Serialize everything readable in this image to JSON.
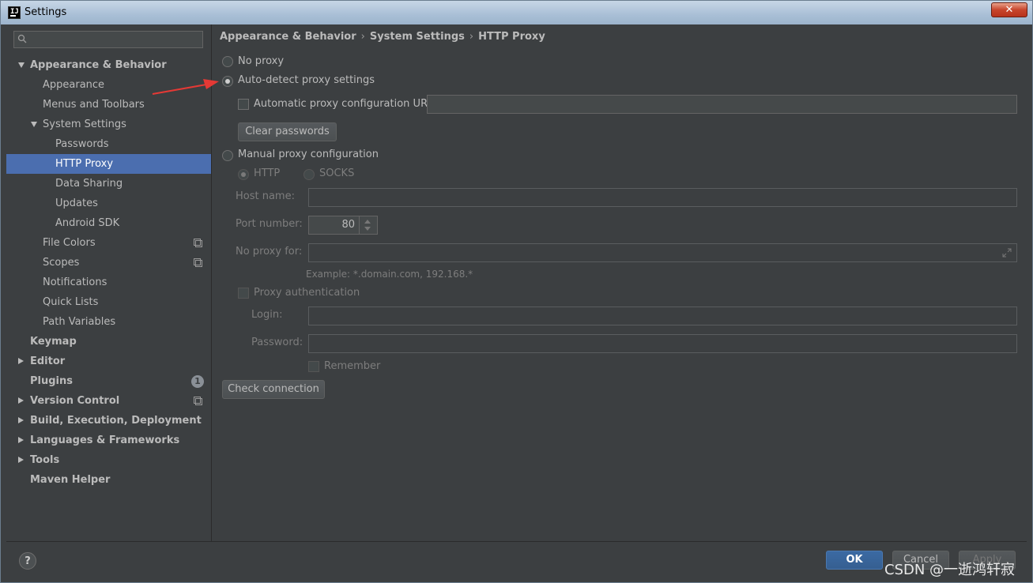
{
  "window": {
    "title": "Settings",
    "close": "✕"
  },
  "app_icon": {
    "glyph": "IJ"
  },
  "sidebar": {
    "search_placeholder": "",
    "items": [
      {
        "label": "Appearance & Behavior"
      },
      {
        "label": "Appearance"
      },
      {
        "label": "Menus and Toolbars"
      },
      {
        "label": "System Settings"
      },
      {
        "label": "Passwords"
      },
      {
        "label": "HTTP Proxy"
      },
      {
        "label": "Data Sharing"
      },
      {
        "label": "Updates"
      },
      {
        "label": "Android SDK"
      },
      {
        "label": "File Colors"
      },
      {
        "label": "Scopes"
      },
      {
        "label": "Notifications"
      },
      {
        "label": "Quick Lists"
      },
      {
        "label": "Path Variables"
      },
      {
        "label": "Keymap"
      },
      {
        "label": "Editor"
      },
      {
        "label": "Plugins",
        "badge": "1"
      },
      {
        "label": "Version Control"
      },
      {
        "label": "Build, Execution, Deployment"
      },
      {
        "label": "Languages & Frameworks"
      },
      {
        "label": "Tools"
      },
      {
        "label": "Maven Helper"
      }
    ]
  },
  "breadcrumb": [
    "Appearance & Behavior",
    "System Settings",
    "HTTP Proxy"
  ],
  "breadcrumb_sep": "›",
  "proxy": {
    "no_proxy": "No proxy",
    "auto_detect": "Auto-detect proxy settings",
    "auto_config_url": "Automatic proxy configuration URL:",
    "auto_config_url_value": "",
    "clear_passwords": "Clear passwords",
    "manual": "Manual proxy configuration",
    "http": "HTTP",
    "socks": "SOCKS",
    "host_name": "Host name:",
    "host_name_value": "",
    "port_number": "Port number:",
    "port_value": "80",
    "no_proxy_for": "No proxy for:",
    "no_proxy_for_value": "",
    "example": "Example: *.domain.com, 192.168.*",
    "proxy_auth": "Proxy authentication",
    "login": "Login:",
    "login_value": "",
    "password": "Password:",
    "password_value": "",
    "remember": "Remember",
    "check_connection": "Check connection",
    "selected_mode": "auto_detect"
  },
  "footer": {
    "help": "?",
    "ok": "OK",
    "cancel": "Cancel",
    "apply": "Apply"
  },
  "watermark": "CSDN @一逝鸿轩寂",
  "colors": {
    "selection": "#4b6eaf",
    "annotation_arrow": "#e53935",
    "ok_button": "#365f91"
  }
}
